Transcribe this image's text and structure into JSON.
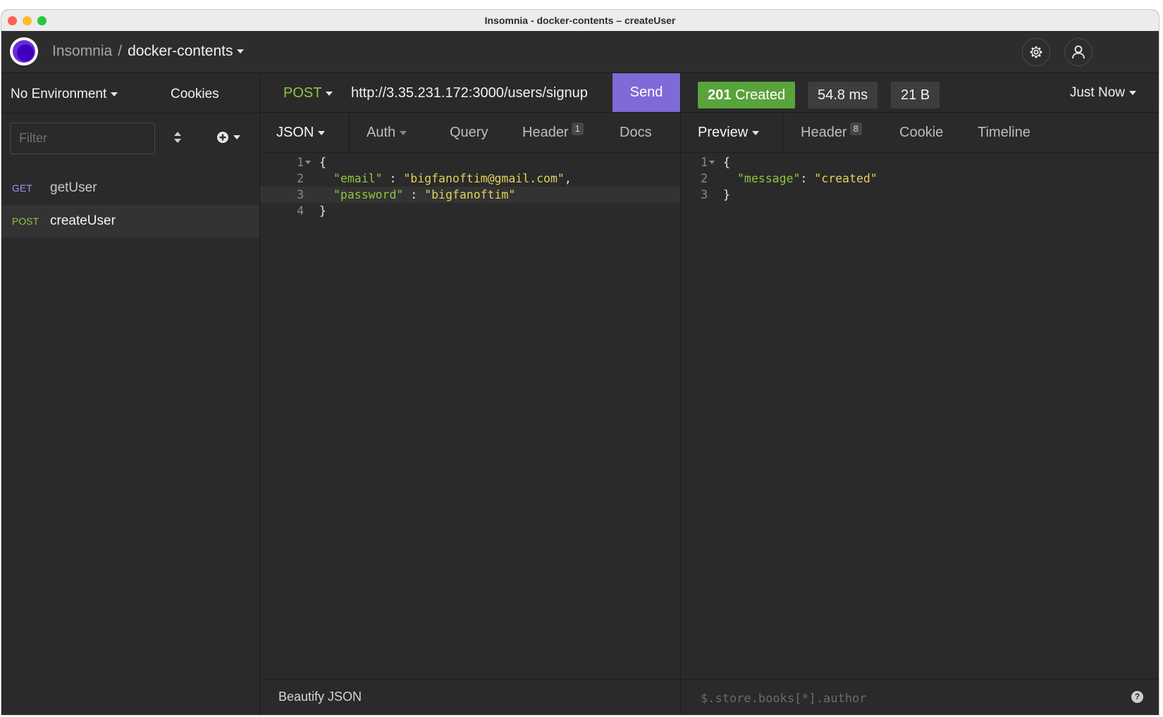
{
  "window": {
    "title": "Insomnia - docker-contents – createUser"
  },
  "header": {
    "app_name": "Insomnia",
    "separator": "/",
    "project_name": "docker-contents"
  },
  "sidebar": {
    "environment": "No Environment",
    "cookies_label": "Cookies",
    "filter_placeholder": "Filter",
    "requests": [
      {
        "method": "GET",
        "name": "getUser",
        "method_color": "#a58cf2",
        "active": false
      },
      {
        "method": "POST",
        "name": "createUser",
        "method_color": "#8fc541",
        "active": true
      }
    ]
  },
  "request": {
    "method": "POST",
    "url": "http://3.35.231.172:3000/users/signup",
    "send_label": "Send",
    "tabs": {
      "body": "JSON",
      "auth": "Auth",
      "query": "Query",
      "header": "Header",
      "header_count": "1",
      "docs": "Docs"
    },
    "body_lines": [
      {
        "n": "1",
        "text": "{"
      },
      {
        "n": "2",
        "key": "\"email\"",
        "sep": " : ",
        "value": "\"bigfanoftim@gmail.com\"",
        "trail": ","
      },
      {
        "n": "3",
        "key": "\"password\"",
        "sep": " : ",
        "value": "\"bigfanoftim\"",
        "trail": ""
      },
      {
        "n": "4",
        "text": "}"
      }
    ],
    "beautify_label": "Beautify JSON"
  },
  "response": {
    "status_code": "201",
    "status_text": "Created",
    "time": "54.8 ms",
    "size": "21 B",
    "history": "Just Now",
    "tabs": {
      "preview": "Preview",
      "header": "Header",
      "header_count": "8",
      "cookie": "Cookie",
      "timeline": "Timeline"
    },
    "body_lines": [
      {
        "n": "1",
        "text": "{"
      },
      {
        "n": "2",
        "key": "\"message\"",
        "sep": ": ",
        "value": "\"created\"",
        "trail": ""
      },
      {
        "n": "3",
        "text": "}"
      }
    ],
    "filter_placeholder": "$.store.books[*].author",
    "help_label": "?"
  },
  "colors": {
    "accent_send": "#7f6ad7",
    "status_success": "#59a33b",
    "json_key": "#8fc541",
    "json_string": "#e2d15b"
  }
}
